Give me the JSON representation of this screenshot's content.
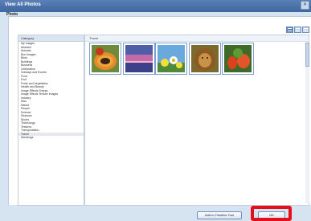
{
  "window": {
    "title": "View All Photos",
    "close_glyph": "✕"
  },
  "section_label": "Photo",
  "category_panel": {
    "header": "Category",
    "items": [
      "My Images",
      "Abstract",
      "Animals",
      "Bus Images",
      "Birds",
      "Buildings",
      "Business",
      "Celebration",
      "Holidays and Events",
      "Food",
      "Fruit",
      "Fruits and Vegetables",
      "Health and Beauty",
      "Image Effects Sharps",
      "Image Effects Texture Images",
      "Industry",
      "Man",
      "Nature",
      "People",
      "Science",
      "Seasons",
      "Sports",
      "Technology",
      "Textures",
      "Transportation",
      "Travel",
      "Weddings"
    ],
    "selected_index": 25
  },
  "gallery": {
    "header": "Travel",
    "thumbnails": [
      {
        "name": "papaya"
      },
      {
        "name": "sunset"
      },
      {
        "name": "flowers"
      },
      {
        "name": "lion"
      },
      {
        "name": "vegetables"
      }
    ]
  },
  "footer": {
    "preview_button": "Add to Timeline Tool",
    "ok_button": "OK"
  },
  "colors": {
    "accent": "#5f86bf",
    "highlight": "#e3101c",
    "thumb_border": "#7a9fd0"
  }
}
